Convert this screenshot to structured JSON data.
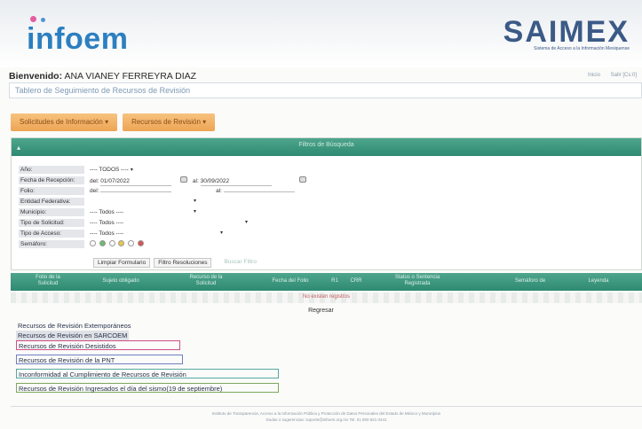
{
  "header": {
    "logo_left": "infoem",
    "logo_right": "SAIMEX",
    "logo_right_sub": "Sistema de Acceso a la Información Mexiquense"
  },
  "welcome": {
    "prefix": "Bienvenido:",
    "user": "ANA VIANEY FERREYRA DIAZ"
  },
  "top_links": [
    "Inicio",
    "Salir [Cs:0]"
  ],
  "subtitle": "Tablero de Seguimiento de Recursos de Revisión",
  "menu": [
    {
      "label": "Solicitudes de Información"
    },
    {
      "label": "Recursos de Revisión"
    }
  ],
  "filter": {
    "title": "Filtros de Búsqueda",
    "fields": {
      "anio": {
        "label": "Año:",
        "value": "---- TODOS ----"
      },
      "fecha": {
        "label": "Fecha de Recepción:",
        "from_prefix": "del:",
        "from": "01/07/2022",
        "to_prefix": "al:",
        "to": "30/09/2022"
      },
      "folio": {
        "label": "Folio:",
        "from_prefix": "del:",
        "to_prefix": "al:"
      },
      "entidad": {
        "label": "Entidad Federativa:",
        "value": ""
      },
      "municipio": {
        "label": "Municipio:",
        "value": "---- Todos ----"
      },
      "tipo_solicitud": {
        "label": "Tipo de Solicitud:",
        "value": "---- Todos ----"
      },
      "tipo_acceso": {
        "label": "Tipo de Acceso:",
        "value": "---- Todos ----"
      },
      "semaforo": {
        "label": "Semáforo:"
      }
    },
    "buttons": {
      "clear": "Limpiar Formulario",
      "filter": "Filtro Resoluciones",
      "search": "Buscar Filtro"
    }
  },
  "table": {
    "headers": [
      "Folio de la Solicitud",
      "Sujeto obligado",
      "Recurso de la Solicitud",
      "Fecha del Folio",
      "R1",
      "CRR",
      "Status o Sentencia Registrada",
      "Semáforo de",
      "Leyenda"
    ],
    "empty_message": "No existen registros"
  },
  "regresar": "Regresar",
  "legend": [
    {
      "label": "Recursos de Revisión Extemporáneos",
      "color": "#f5f5f5"
    },
    {
      "label": "Recursos de Revisión en SARCOEM",
      "color": "#dcdfe3"
    },
    {
      "label": "Recursos de Revisión Desistidos",
      "color": "#cf4f86"
    },
    {
      "label": "Recursos de Revisión de la PNT",
      "color": "#6f7fc0"
    },
    {
      "label": "Inconformidad al Cumplimiento de Recursos de Revisión",
      "color": "#59a7a0"
    },
    {
      "label": "Recursos de Revisión Ingresados el día del sismo(19 de septiembre)",
      "color": "#7ea85e"
    }
  ],
  "footer": {
    "line1": "Instituto de Transparencia, Acceso a la Información Pública y Protección de Datos Personales del Estado de México y Municipios",
    "line2": "Dudas o sugerencias: soporte@infoem.org.mx  Tel. 01 800 821 0441"
  }
}
